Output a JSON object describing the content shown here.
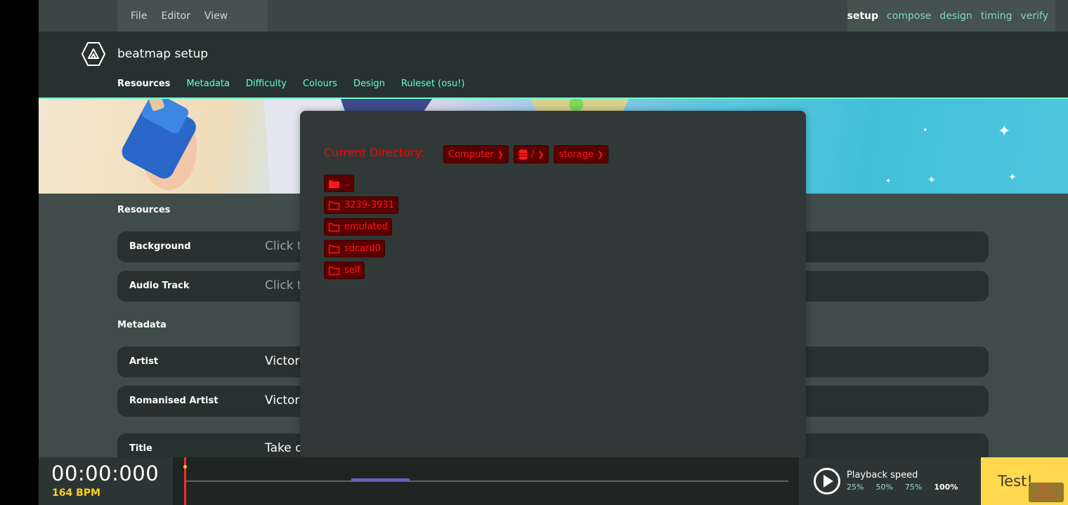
{
  "menu": {
    "items": [
      "File",
      "Editor",
      "View"
    ]
  },
  "modes": {
    "items": [
      "setup",
      "compose",
      "design",
      "timing",
      "verify"
    ],
    "active": "setup"
  },
  "header": {
    "title": "beatmap setup",
    "tabs": [
      "Resources",
      "Metadata",
      "Difficulty",
      "Colours",
      "Design",
      "Ruleset (osu!)"
    ],
    "active_tab": "Resources"
  },
  "sections": {
    "resources": {
      "title": "Resources",
      "rows": [
        {
          "label": "Background",
          "value": "Click t"
        },
        {
          "label": "Audio Track",
          "value": "Click t"
        }
      ]
    },
    "metadata": {
      "title": "Metadata",
      "rows": [
        {
          "label": "Artist",
          "value": "Victor"
        },
        {
          "label": "Romanised Artist",
          "value": "Victor"
        },
        {
          "label": "Title",
          "value": "Take o"
        }
      ]
    }
  },
  "file_dialog": {
    "current_directory_label": "Current Directory:",
    "breadcrumbs": [
      "Computer",
      "/",
      "storage"
    ],
    "entries": [
      "..",
      "3239-3931",
      "emulated",
      "sdcard0",
      "self"
    ]
  },
  "bottom": {
    "clock": "00:00:000",
    "bpm": "164 BPM",
    "playback_label": "Playback speed",
    "speeds": [
      "25%",
      "50%",
      "75%",
      "100%"
    ],
    "active_speed": "100%",
    "test_label": "Test!",
    "fps_line1": "12ms",
    "fps_line2": "181ms"
  },
  "colors": {
    "accent": "#66ffcc",
    "dialog_text": "#ff1a1a",
    "bpm": "#ffcc22",
    "test_button": "#ffd84d"
  }
}
